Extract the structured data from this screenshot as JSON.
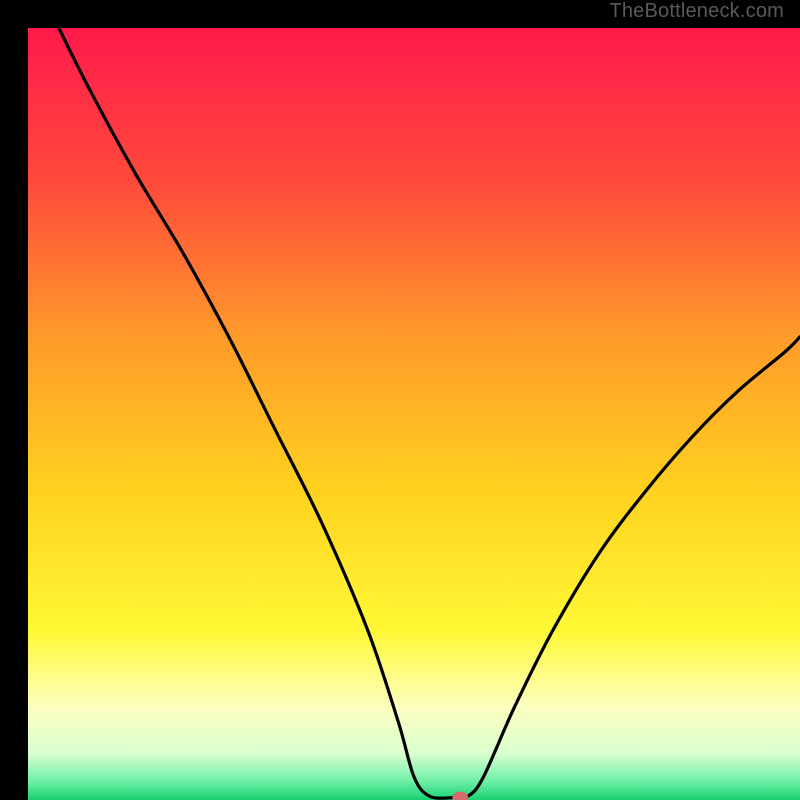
{
  "watermark": "TheBottleneck.com",
  "chart_data": {
    "type": "line",
    "title": "",
    "xlabel": "",
    "ylabel": "",
    "xlim": [
      0,
      100
    ],
    "ylim": [
      0,
      100
    ],
    "gradient_stops": [
      {
        "offset": 0,
        "color": "#ff1a4b"
      },
      {
        "offset": 0.2,
        "color": "#ff4a3c"
      },
      {
        "offset": 0.4,
        "color": "#ff9a2a"
      },
      {
        "offset": 0.6,
        "color": "#ffd21f"
      },
      {
        "offset": 0.78,
        "color": "#fff835"
      },
      {
        "offset": 0.88,
        "color": "#fdffc0"
      },
      {
        "offset": 0.94,
        "color": "#d9ffd0"
      },
      {
        "offset": 0.975,
        "color": "#70f0a8"
      },
      {
        "offset": 1.0,
        "color": "#18d070"
      }
    ],
    "curve_points": [
      {
        "x": 4,
        "y": 100
      },
      {
        "x": 8,
        "y": 92
      },
      {
        "x": 14,
        "y": 81
      },
      {
        "x": 20,
        "y": 71
      },
      {
        "x": 26,
        "y": 60
      },
      {
        "x": 32,
        "y": 48
      },
      {
        "x": 38,
        "y": 36
      },
      {
        "x": 44,
        "y": 22
      },
      {
        "x": 48,
        "y": 10
      },
      {
        "x": 50,
        "y": 3
      },
      {
        "x": 52,
        "y": 0.5
      },
      {
        "x": 55,
        "y": 0.3
      },
      {
        "x": 57,
        "y": 0.5
      },
      {
        "x": 59,
        "y": 3
      },
      {
        "x": 63,
        "y": 12
      },
      {
        "x": 68,
        "y": 22
      },
      {
        "x": 74,
        "y": 32
      },
      {
        "x": 80,
        "y": 40
      },
      {
        "x": 86,
        "y": 47
      },
      {
        "x": 92,
        "y": 53
      },
      {
        "x": 98,
        "y": 58
      },
      {
        "x": 100,
        "y": 60
      }
    ],
    "marker": {
      "x": 56,
      "y": 0.3,
      "color": "#d66a6a"
    }
  }
}
